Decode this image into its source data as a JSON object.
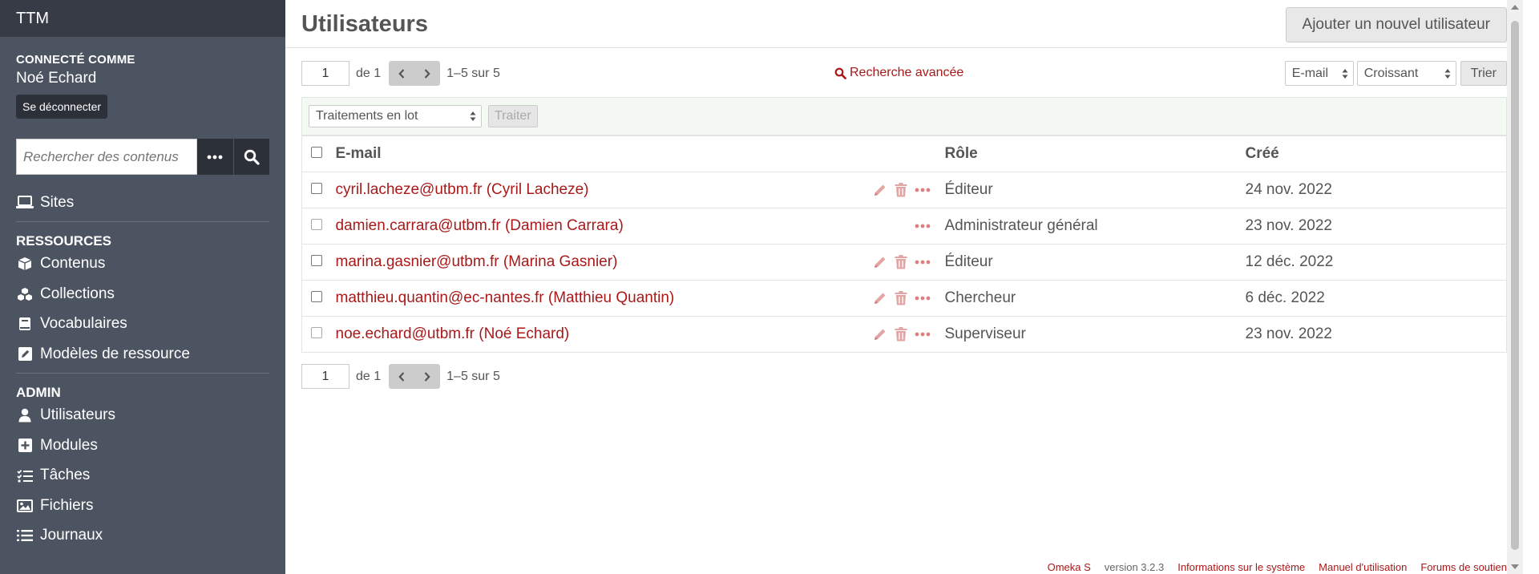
{
  "sidebar": {
    "brand": "TTM",
    "logged_in_label": "CONNECTÉ COMME",
    "user_name": "Noé Echard",
    "logout_label": "Se déconnecter",
    "search_placeholder": "Rechercher des contenus",
    "sites_label": "Sites",
    "resources_title": "RESSOURCES",
    "resources": [
      {
        "label": "Contenus",
        "icon": "cube-icon"
      },
      {
        "label": "Collections",
        "icon": "cubes-icon"
      },
      {
        "label": "Vocabulaires",
        "icon": "book-icon"
      },
      {
        "label": "Modèles de ressource",
        "icon": "pencil-square-icon"
      }
    ],
    "admin_title": "ADMIN",
    "admin": [
      {
        "label": "Utilisateurs",
        "icon": "user-icon"
      },
      {
        "label": "Modules",
        "icon": "plus-square-icon"
      },
      {
        "label": "Tâches",
        "icon": "tasks-icon"
      },
      {
        "label": "Fichiers",
        "icon": "image-icon"
      },
      {
        "label": "Journaux",
        "icon": "list-icon"
      }
    ]
  },
  "header": {
    "title": "Utilisateurs",
    "add_button": "Ajouter un nouvel utilisateur"
  },
  "pagination": {
    "page": "1",
    "of": "de 1",
    "range": "1–5 sur 5"
  },
  "advanced_search": "Recherche avancée",
  "sort": {
    "by": "E-mail",
    "order": "Croissant",
    "button": "Trier"
  },
  "batch": {
    "select": "Traitements en lot",
    "button": "Traiter"
  },
  "table": {
    "headers": {
      "email": "E-mail",
      "role": "Rôle",
      "created": "Créé"
    },
    "rows": [
      {
        "email": "cyril.lacheze@utbm.fr (Cyril Lacheze)",
        "role": "Éditeur",
        "created": "24 nov. 2022"
      },
      {
        "email": "damien.carrara@utbm.fr (Damien Carrara)",
        "role": "Administrateur général",
        "created": "23 nov. 2022"
      },
      {
        "email": "marina.gasnier@utbm.fr (Marina Gasnier)",
        "role": "Éditeur",
        "created": "12 déc. 2022"
      },
      {
        "email": "matthieu.quantin@ec-nantes.fr (Matthieu Quantin)",
        "role": "Chercheur",
        "created": "6 déc. 2022"
      },
      {
        "email": "noe.echard@utbm.fr (Noé Echard)",
        "role": "Superviseur",
        "created": "23 nov. 2022"
      }
    ]
  },
  "footer": {
    "product": "Omeka S",
    "version": "version 3.2.3",
    "system_info": "Informations sur le système",
    "manual": "Manuel d'utilisation",
    "forums": "Forums de soutien"
  },
  "colors": {
    "sidebar": "#4d5461",
    "sidebar_dark": "#363b45",
    "link": "#a91919"
  }
}
